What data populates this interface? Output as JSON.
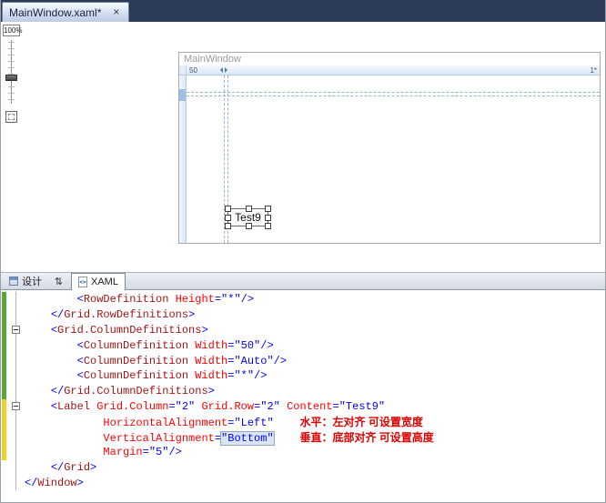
{
  "colors": {
    "tab_strip_bg": "#2C3B58",
    "change_green": "#57A839",
    "change_yellow": "#F0D121",
    "syntax_tag": "#A31515",
    "syntax_attr": "#FF0000",
    "syntax_value": "#0000FF",
    "annotation": "#DD0000",
    "grid_line": "#98B3D2"
  },
  "titlebar": {
    "tab_label": "MainWindow.xaml*",
    "close_glyph": "×"
  },
  "zoom_panel": {
    "zoom_value": "100%"
  },
  "designer": {
    "window_title": "MainWindow",
    "ruler_left_label": "50",
    "ruler_right_label": "1*",
    "selected_control_text": "Test9"
  },
  "pane_switcher": {
    "design_label": "设计",
    "swap_glyph": "⇅",
    "xaml_label": "XAML",
    "xaml_icon_glyph": "<>"
  },
  "editor": {
    "lines": [
      {
        "bar": "green",
        "fold": "",
        "tokens": [
          [
            "w",
            "        "
          ],
          [
            "d",
            "<"
          ],
          [
            "t",
            "RowDefinition"
          ],
          [
            "w",
            " "
          ],
          [
            "a",
            "Height"
          ],
          [
            "d",
            "=\"*\"/>"
          ]
        ]
      },
      {
        "bar": "green",
        "fold": "",
        "tokens": [
          [
            "w",
            "    "
          ],
          [
            "d",
            "</"
          ],
          [
            "t",
            "Grid.RowDefinitions"
          ],
          [
            "d",
            ">"
          ]
        ]
      },
      {
        "bar": "green",
        "fold": "box",
        "tokens": [
          [
            "w",
            "    "
          ],
          [
            "d",
            "<"
          ],
          [
            "t",
            "Grid.ColumnDefinitions"
          ],
          [
            "d",
            ">"
          ]
        ]
      },
      {
        "bar": "green",
        "fold": "",
        "tokens": [
          [
            "w",
            "        "
          ],
          [
            "d",
            "<"
          ],
          [
            "t",
            "ColumnDefinition"
          ],
          [
            "w",
            " "
          ],
          [
            "a",
            "Width"
          ],
          [
            "d",
            "=\"50\"/>"
          ]
        ]
      },
      {
        "bar": "green",
        "fold": "",
        "tokens": [
          [
            "w",
            "        "
          ],
          [
            "d",
            "<"
          ],
          [
            "t",
            "ColumnDefinition"
          ],
          [
            "w",
            " "
          ],
          [
            "a",
            "Width"
          ],
          [
            "d",
            "=\"Auto\"/>"
          ]
        ]
      },
      {
        "bar": "green",
        "fold": "",
        "tokens": [
          [
            "w",
            "        "
          ],
          [
            "d",
            "<"
          ],
          [
            "t",
            "ColumnDefinition"
          ],
          [
            "w",
            " "
          ],
          [
            "a",
            "Width"
          ],
          [
            "d",
            "=\"*\"/>"
          ]
        ]
      },
      {
        "bar": "green",
        "fold": "",
        "tokens": [
          [
            "w",
            "    "
          ],
          [
            "d",
            "</"
          ],
          [
            "t",
            "Grid.ColumnDefinitions"
          ],
          [
            "d",
            ">"
          ]
        ]
      },
      {
        "bar": "yellow",
        "fold": "box",
        "tokens": [
          [
            "w",
            "    "
          ],
          [
            "d",
            "<"
          ],
          [
            "t",
            "Label"
          ],
          [
            "w",
            " "
          ],
          [
            "a",
            "Grid.Column"
          ],
          [
            "d",
            "=\"2\""
          ],
          [
            "w",
            " "
          ],
          [
            "a",
            "Grid.Row"
          ],
          [
            "d",
            "=\"2\""
          ],
          [
            "w",
            " "
          ],
          [
            "a",
            "Content"
          ],
          [
            "d",
            "=\"Test9\""
          ]
        ]
      },
      {
        "bar": "yellow",
        "fold": "",
        "tokens": [
          [
            "w",
            "            "
          ],
          [
            "a",
            "HorizontalAlignment"
          ],
          [
            "d",
            "=\"Left\""
          ],
          [
            "w",
            "    "
          ],
          [
            "n",
            "水平：左对齐 可设置宽度"
          ]
        ]
      },
      {
        "bar": "yellow",
        "fold": "",
        "tokens": [
          [
            "w",
            "            "
          ],
          [
            "a",
            "VerticalAlignment"
          ],
          [
            "d",
            "="
          ],
          [
            "h",
            "\"Bottom\""
          ],
          [
            "w",
            "    "
          ],
          [
            "n",
            "垂直：底部对齐 可设置高度"
          ]
        ]
      },
      {
        "bar": "yellow",
        "fold": "",
        "tokens": [
          [
            "w",
            "            "
          ],
          [
            "a",
            "Margin"
          ],
          [
            "d",
            "=\"5\"/>"
          ]
        ]
      },
      {
        "bar": "",
        "fold": "",
        "tokens": [
          [
            "w",
            "    "
          ],
          [
            "d",
            "</"
          ],
          [
            "t",
            "Grid"
          ],
          [
            "d",
            ">"
          ]
        ]
      },
      {
        "bar": "",
        "fold": "",
        "tokens": [
          [
            "d",
            "</"
          ],
          [
            "t",
            "Window"
          ],
          [
            "d",
            ">"
          ]
        ]
      }
    ]
  }
}
